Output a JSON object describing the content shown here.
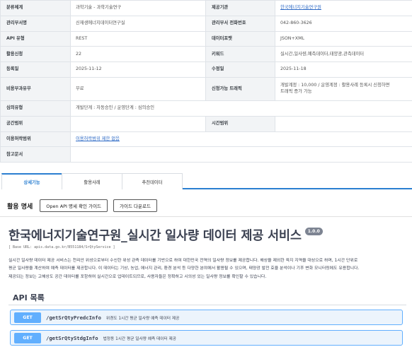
{
  "meta_rows": [
    {
      "k1": "분류체계",
      "v1": "과학기술 - 과학기술연구",
      "k2": "제공기관",
      "v2": "한국에너지기술연구원"
    },
    {
      "k1": "관리부서명",
      "v1": "신재생에너지데이터연구실",
      "k2": "관리부서 전화번호",
      "v2": "042-860-3626"
    },
    {
      "k1": "API 유형",
      "v1": "REST",
      "k2": "데이터포맷",
      "v2": "JSON+XML"
    },
    {
      "k1": "활용신청",
      "v1": "22",
      "k2": "키워드",
      "v2": "실시간,일사량,예측데이터,태양광,관측데이터"
    },
    {
      "k1": "등록일",
      "v1": "2025-11-12",
      "k2": "수정일",
      "v2": "2025-11-18"
    },
    {
      "k1": "비용부과유무",
      "v1": "무료",
      "k2": "신청가능 트래픽",
      "v2_line1": "개발계정 : 10,000 / 운영계정 : 활용사례 등록시 신청하면",
      "v2_line2": "트래픽 증가 가능"
    },
    {
      "k1": "심의유형",
      "v1": "개발단계 : 자동승인 / 운영단계 : 심의승인"
    },
    {
      "k1": "공간범위",
      "v1": "",
      "k2": "시간범위",
      "v2": ""
    },
    {
      "k1": "이용허락범위",
      "v1": "이용허락범위 제한 없음"
    },
    {
      "k1": "참고문서",
      "v1": ""
    }
  ],
  "tabs": [
    "상세기능",
    "활용사례",
    "추천데이터"
  ],
  "spec": {
    "title": "활용 명세",
    "guide_button": "Open API 명세 확인 가이드",
    "download_button": "가이드 다운로드"
  },
  "service": {
    "title": "한국에너지기술연구원_실시간 일사량 데이터 제공 서비스",
    "version": "1.0.0",
    "base_url": "[ Base URL: apis.data.go.kr/B551184/SrQtyService ]",
    "description": [
      "실시간 일사량 데이터 제공 서비스는 천리안 위성으로부터 수신한 위성 관측 데이터를 기반으로 하여 대한민국 전역의 일사량 정보를 제공합니다. 해상을 제외한 육지 지역을 대상으로 하며, 1시간 단위로",
      "평균 일사량을 계산하여 예측 데이터를 제공합니다. 이 데이터는 기상, 농업, 에너지 관리, 환경 분석 등 다양한 분야에서 활용될 수 있으며, 태양광 발전 효율 분석이나 기후 변화 모니터링에도 유용합니다.",
      "제공되는 정보는 고해상도 공간 데이터를 포함하여 실시간으로 업데이트되므로, 사용자들은 정확하고 시의성 있는 일사량 정보를 확인할 수 있습니다."
    ]
  },
  "api_list": {
    "title": "API 목록",
    "operations": [
      {
        "method": "GET",
        "path": "/getSrQtyPredcInfo",
        "desc": "위경도 1시간 평균 일사량 예측 데이터 제공"
      },
      {
        "method": "GET",
        "path": "/getSrQtyStdgInfo",
        "desc": "법정동 1시간 평균 일사량 예측 데이터 제공"
      }
    ]
  },
  "colors": {
    "tab_accent": "#2b7fd1",
    "get_method": "#61affe",
    "get_bg": "#ecf4fc",
    "link": "#2f6bc6"
  }
}
